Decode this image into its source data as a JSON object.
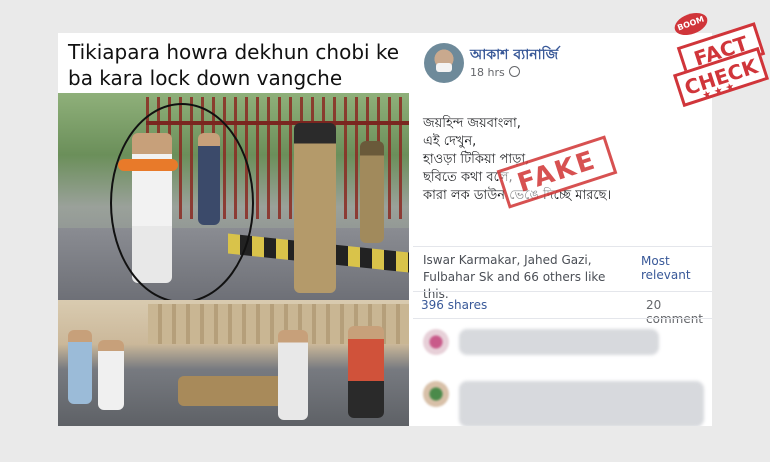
{
  "image_caption": "Tikiapara howra dekhun chobi ke ba kara lock down vangche",
  "post": {
    "author": "আকাশ ব্যানার্জি",
    "time": "18 hrs",
    "body_lines": [
      "জয়হিন্দ জয়বাংলা,",
      "এই দেখুন,",
      "হাওড়া টিকিয়া পাড়া,",
      "ছবিতে কথা বলে,",
      "কারা লক ডাউন ভেঙে দিচ্ছে মারছে।"
    ],
    "stamp": "FAKE",
    "likes": "Iswar Karmakar, Jahed Gazi, Fulbahar Sk and 66 others like this.",
    "sort_label": "Most relevant",
    "shares": "396 shares",
    "comments": "20 comment"
  },
  "badge": {
    "top": "BOOM",
    "line1": "FACT",
    "line2": "CHECK",
    "stars": "★ ★ ★"
  },
  "colors": {
    "link": "#385898",
    "stamp": "#d23a3a",
    "badge": "#d0353a"
  }
}
